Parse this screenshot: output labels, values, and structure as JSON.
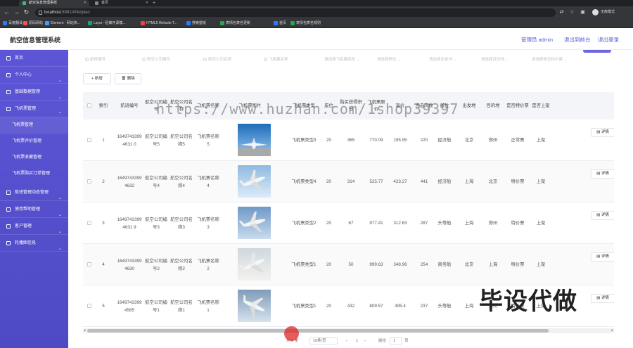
{
  "browser": {
    "tabs": [
      {
        "title": "航空信息管理系统"
      },
      {
        "title": "首页"
      }
    ],
    "url_host": "localhost",
    "url_rest": ":8081/#/fei/plao",
    "profile_name": "无痕模式",
    "bookmarks": [
      "百度翻译",
      "原码网站",
      "Element - 网站快...",
      "Layui - 经典开源模...",
      "HTML5 Website T...",
      "搜索壁纸",
      "表情包表名更新",
      "首页",
      "表情包表名规则"
    ]
  },
  "header": {
    "title": "航空信息管理系统",
    "admin_label": "管理员 admin",
    "back_label": "退出到前台",
    "logout_label": "退出登录"
  },
  "sidebar": {
    "items": [
      {
        "label": "首页",
        "expanded": false
      },
      {
        "label": "个人中心",
        "expanded": false
      },
      {
        "label": "基础数据管理",
        "expanded": false
      },
      {
        "label": "飞机票管理",
        "expanded": true
      }
    ],
    "sub_items": [
      "飞机票管理",
      "飞机票评价管理",
      "飞机票收藏管理",
      "飞机票购买订单管理"
    ],
    "items_after": [
      {
        "label": "航班管理动态管理"
      },
      {
        "label": "使用帮助管理"
      },
      {
        "label": "客户管理"
      },
      {
        "label": "轮播图信息"
      }
    ]
  },
  "search": {
    "inputs": [
      "航班编号",
      "航空公司编号",
      "航空公司名称",
      "飞机票名称"
    ],
    "selects": [
      "请选择飞机票类型",
      "请选择舱位",
      "请选择出发地",
      "请选择目的地",
      "请选择是否特价票"
    ]
  },
  "toolbar": {
    "add_label": "+ 新增",
    "delete_label": "删除"
  },
  "table": {
    "headers": [
      "索引",
      "航班编号",
      "航空公司编号",
      "航空公司名称",
      "飞机票名称",
      "飞机票图片",
      "飞机票类型",
      "座位",
      "购买获得积分",
      "飞机票原价",
      "现价",
      "点击次数",
      "舱位",
      "出发地",
      "目的地",
      "是否特价票",
      "是否上架"
    ],
    "rows": [
      {
        "index": "1",
        "flight_no": "16497433994631 0",
        "company_no": "航空公司编号5",
        "company_name": "航空公司名称5",
        "ticket_name": "飞机票名称5",
        "ticket_type": "飞机票类型3",
        "seats": "20",
        "points": "365",
        "orig_price": "770.09",
        "price": "195.95",
        "clicks": "220",
        "cabin": "经济舱",
        "from": "北京",
        "to": "郑州",
        "special": "正常票",
        "status": "上架"
      },
      {
        "index": "2",
        "flight_no": "16497433994632",
        "company_no": "航空公司编号4",
        "company_name": "航空公司名称4",
        "ticket_name": "飞机票名称4",
        "ticket_type": "飞机票类型4",
        "seats": "20",
        "points": "314",
        "orig_price": "525.77",
        "price": "423.27",
        "clicks": "441",
        "cabin": "经济舱",
        "from": "上海",
        "to": "北京",
        "special": "特价票",
        "status": "上架"
      },
      {
        "index": "3",
        "flight_no": "16497433994631 9",
        "company_no": "航空公司编号3",
        "company_name": "航空公司名称3",
        "ticket_name": "飞机票名称3",
        "ticket_type": "飞机票类型2",
        "seats": "20",
        "points": "67",
        "orig_price": "977.41",
        "price": "312.63",
        "clicks": "287",
        "cabin": "头等舱",
        "from": "上海",
        "to": "郑州",
        "special": "特价票",
        "status": "上架"
      },
      {
        "index": "4",
        "flight_no": "16497433994630",
        "company_no": "航空公司编号2",
        "company_name": "航空公司名称2",
        "ticket_name": "飞机票名称2",
        "ticket_type": "飞机票类型1",
        "seats": "20",
        "points": "50",
        "orig_price": "999.63",
        "price": "348.96",
        "clicks": "254",
        "cabin": "商务舱",
        "from": "北京",
        "to": "上海",
        "special": "特价票",
        "status": "上架"
      },
      {
        "index": "5",
        "flight_no": "16497433994585",
        "company_no": "航空公司编号1",
        "company_name": "航空公司名称1",
        "ticket_name": "飞机票名称1",
        "ticket_type": "飞机票类型1",
        "seats": "20",
        "points": "432",
        "orig_price": "809.57",
        "price": "395.4",
        "clicks": "237",
        "cabin": "头等舱",
        "from": "上海",
        "to": "郑州",
        "special": "特价票",
        "status": "上架"
      }
    ],
    "detail_label": "详情"
  },
  "pagination": {
    "total": "共 5 条",
    "page_size": "10条/页",
    "current_page": "1",
    "goto_label": "前往",
    "goto_value": "1",
    "page_unit": "页"
  },
  "watermark": "https://www.huzhan.com/1shop39397",
  "stamp": "毕设代做",
  "colors": {
    "sidebar": "#5d55d6",
    "accent": "#4c5bd0",
    "browser_chrome": "#35363a"
  }
}
